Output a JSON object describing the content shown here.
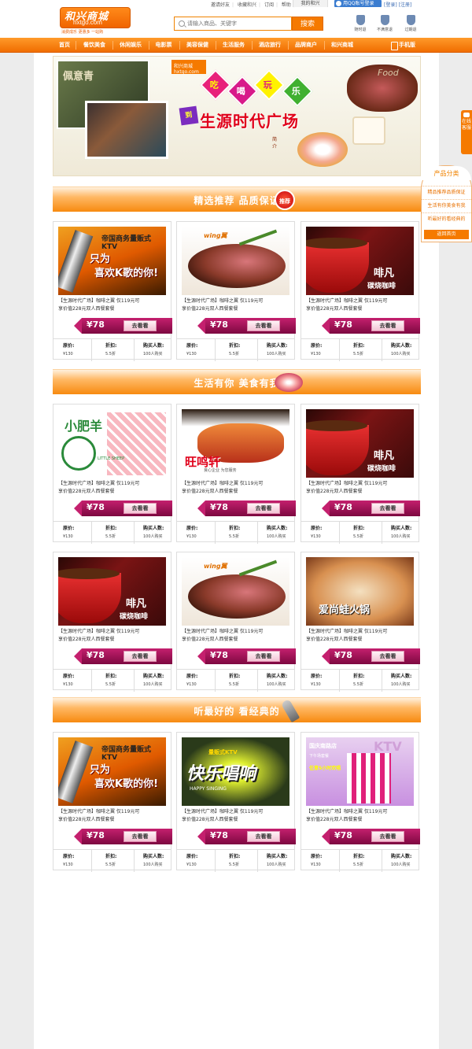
{
  "header": {
    "logo_cn": "和兴商城",
    "logo_en": "hxtgo.com",
    "logo_slogan": "消费成乐  更惠多  一站购",
    "search_placeholder": "请输入商品、关键字",
    "search_button": "搜索",
    "top_links": [
      "邀请好友",
      "收藏和兴",
      "订阅",
      "帮助",
      "反馈"
    ],
    "my_site": "我的和兴",
    "qq_login": "用QQ账号登录",
    "login": "[登录]",
    "register": "[注册]",
    "guarantees": [
      "随时退",
      "不满意退",
      "过期退"
    ]
  },
  "nav": {
    "items": [
      "首页",
      "餐饮美食",
      "休闲娱乐",
      "电影票",
      "美容保健",
      "生活服务",
      "酒店旅行",
      "品牌商户",
      "和兴商城"
    ],
    "mobile": "手机版"
  },
  "banner": {
    "logo": "和兴商城 hxtgo.com",
    "chars": [
      "吃",
      "喝",
      "玩",
      "乐"
    ],
    "badge": "到",
    "title": "生源时代广场",
    "side_text": "简介",
    "english": "Food",
    "shop_sign": "佩意青"
  },
  "sections": [
    {
      "title": "精选推荐  品质保证",
      "badge": "推荐"
    },
    {
      "title": "生活有你  美食有我"
    },
    {
      "title": "听最好的  看经典的"
    }
  ],
  "products": {
    "desc_line1": "【生源时代广场】咖啡之翼 仅119元可",
    "desc_line2": "享价值228元双人西餐套餐",
    "price": "¥78",
    "go_label": "去看看",
    "stats": {
      "orig_label": "原价:",
      "orig_value": "¥130",
      "discount_label": "折扣:",
      "discount_value": "5.5折",
      "buyers_label": "购买人数:",
      "buyers_value": "100人购买"
    },
    "images": {
      "ktv_t1": "帝国商务量贩式KTV",
      "ktv_t2": "只为",
      "ktv_t3": "喜欢K歌的你!",
      "wing": "wing翼",
      "coffee_t1": "啡凡",
      "coffee_t2": "碳烧咖啡",
      "sheep_t1": "小肥羊",
      "sheep_t2": "LITTLE SHEEP",
      "fish_t1": "旺鸣轩",
      "fish_t2": "良心企业 为您服务",
      "hotpot_t1": "爱尚蛙火锅",
      "happy_t1": "快乐唱响",
      "happy_t2": "量贩式KTV",
      "happy_t3": "HAPPY SINGING",
      "ktv2_t1": "国庆南路店",
      "ktv2_t2": "下午场套餐",
      "ktv2_t3": "任意5小时欢唱",
      "ktv2_t4": "KTV"
    }
  },
  "sidebar": {
    "chat": "在线客服",
    "category_title": "产品分类",
    "categories": [
      "精品推荐品质保证",
      "生活有你美食有我",
      "听最好的看经典的"
    ],
    "home": "返回首页"
  }
}
